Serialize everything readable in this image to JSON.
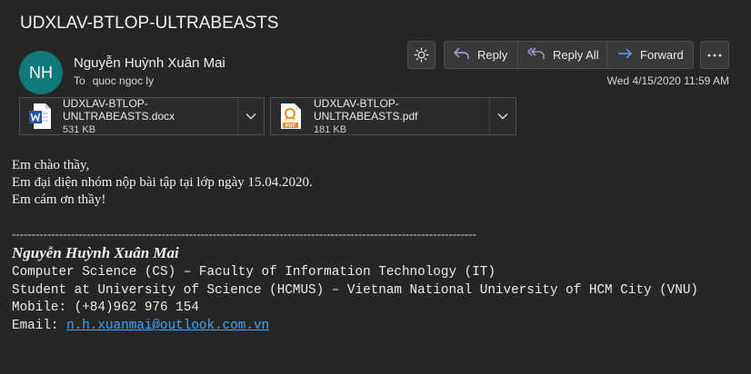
{
  "subject": "UDXLAV-BTLOP-ULTRABEASTS",
  "sender": {
    "initials": "NH",
    "name": "Nguyễn Huỳnh Xuân Mai",
    "avatar_color": "#0f7a7a"
  },
  "recipients": {
    "to_label": "To",
    "to_name": "quoc ngoc ly"
  },
  "date": "Wed 4/15/2020 11:59 AM",
  "toolbar": {
    "theme_icon": "sun-icon",
    "reply_label": "Reply",
    "reply_all_label": "Reply All",
    "forward_label": "Forward",
    "more_icon": "more-icon"
  },
  "attachments": [
    {
      "name": "UDXLAV-BTLOP-UNLTRABEASTS.docx",
      "size": "531 KB",
      "icon": "word-doc-icon"
    },
    {
      "name": "UDXLAV-BTLOP-UNLTRABEASTS.pdf",
      "size": "181 KB",
      "icon": "pdf-icon"
    }
  ],
  "body": {
    "lines": [
      "Em chào thầy,",
      "Em đại diện nhóm nộp bài tập tại lớp ngày 15.04.2020.",
      "Em cám ơn thầy!"
    ]
  },
  "signature": {
    "divider": "----------------------------------------------------------------------------------------------------------------------",
    "name": "Nguyễn Huỳnh Xuân Mai",
    "line1": "Computer Science (CS) – Faculty of Information Technology (IT)",
    "line2": "Student at University of Science (HCMUS) – Vietnam National University of HCM City (VNU)",
    "line3": "Mobile: (+84)962 976 154",
    "email_label": "Email: ",
    "email": "n.h.xuanmai@outlook.com.vn"
  },
  "colors": {
    "background": "#262626",
    "link": "#3ea6ff",
    "reply_icon": "#b4a0e6",
    "forward_icon": "#5fa8ff"
  }
}
